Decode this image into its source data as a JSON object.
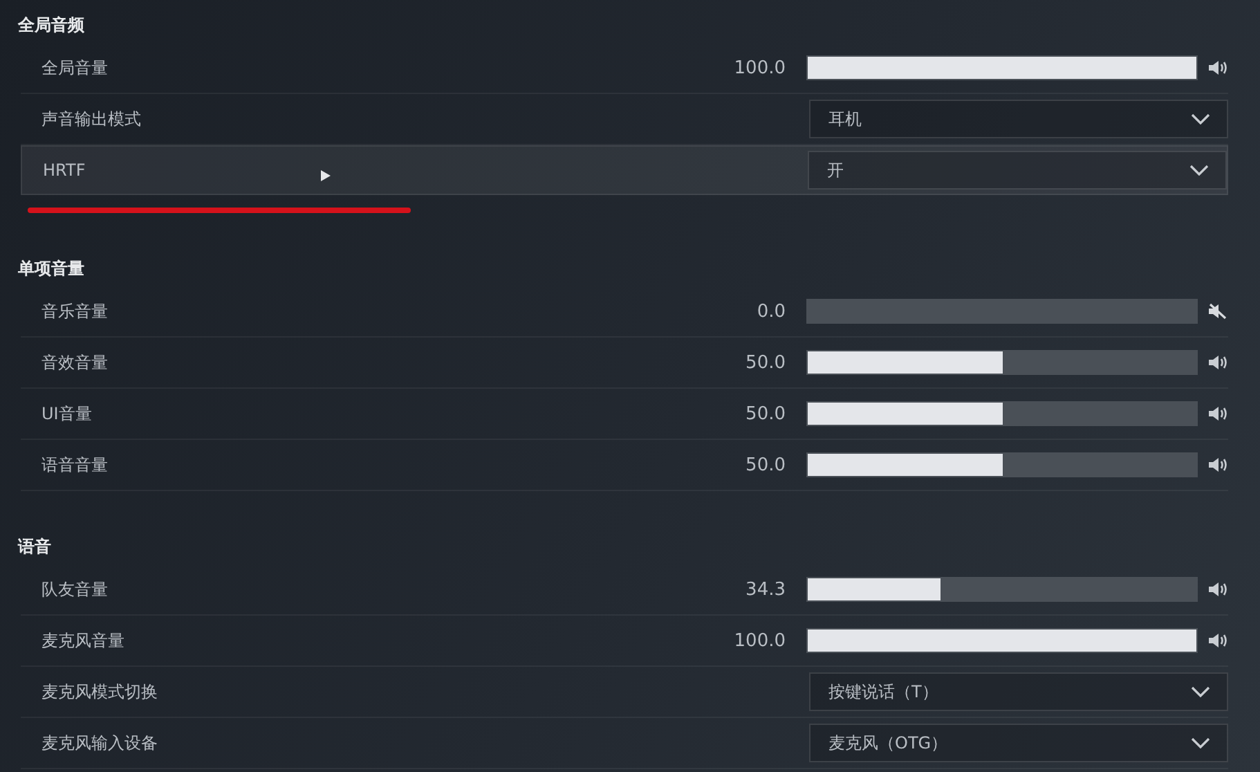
{
  "sections": [
    {
      "title": "全局音频",
      "rows": [
        {
          "kind": "slider",
          "label": "全局音量",
          "reading": "100.0",
          "level": 1,
          "muted": false,
          "highlighted": false
        },
        {
          "kind": "dropdown",
          "label": "声音输出模式",
          "value": "耳机",
          "highlighted": false
        },
        {
          "kind": "dropdown",
          "label": "HRTF",
          "value": "开",
          "highlighted": true,
          "underlined": true,
          "pointer": true
        }
      ]
    },
    {
      "title": "单项音量",
      "rows": [
        {
          "kind": "slider",
          "label": "音乐音量",
          "reading": "0.0",
          "muted": true,
          "highlighted": false
        },
        {
          "kind": "slider",
          "label": "音效音量",
          "reading": "50.0",
          "level": 0.5,
          "muted": false,
          "highlighted": false
        },
        {
          "kind": "slider",
          "label": "UI音量",
          "reading": "50.0",
          "level": 0.5,
          "muted": false,
          "highlighted": false
        },
        {
          "kind": "slider",
          "label": "语音音量",
          "reading": "50.0",
          "level": 0.5,
          "muted": false,
          "highlighted": false
        }
      ]
    },
    {
      "title": "语音",
      "rows": [
        {
          "kind": "slider",
          "label": "队友音量",
          "reading": "34.3",
          "level": 0.343,
          "muted": false,
          "highlighted": false
        },
        {
          "kind": "slider",
          "label": "麦克风音量",
          "reading": "100.0",
          "level": 1,
          "muted": false,
          "highlighted": false
        },
        {
          "kind": "dropdown",
          "label": "麦克风模式切换",
          "value": "按键说话（T）",
          "highlighted": false
        },
        {
          "kind": "dropdown",
          "label": "麦克风输入设备",
          "value": "麦克风（OTG）",
          "highlighted": false
        }
      ]
    }
  ]
}
